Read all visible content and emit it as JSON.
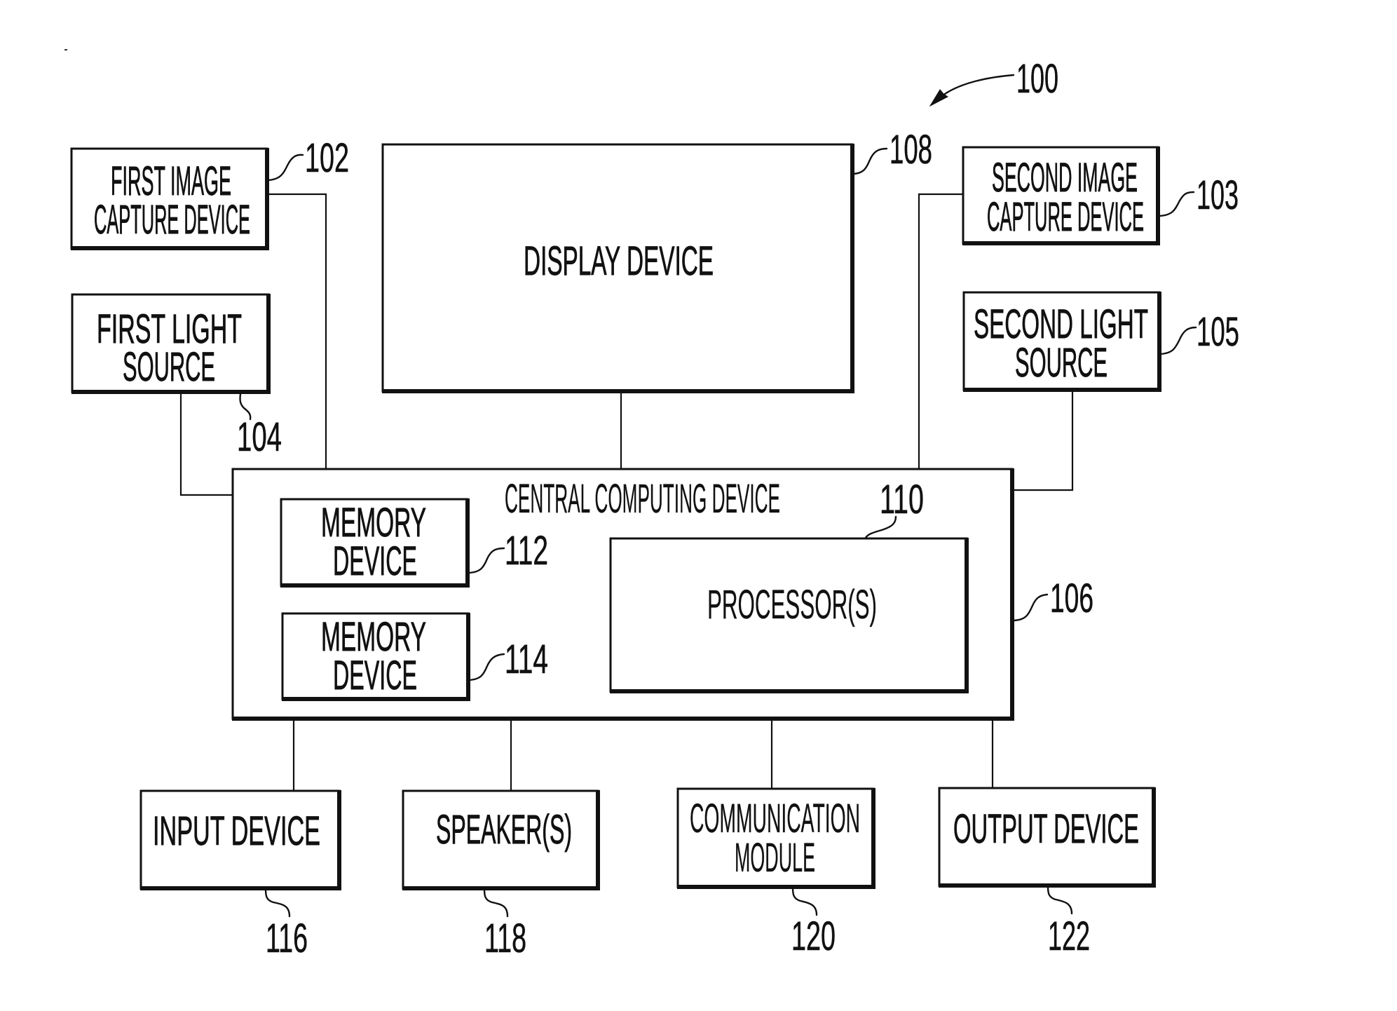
{
  "figure": {
    "ref": "100"
  },
  "blocks": {
    "first_image_capture_device": {
      "lines": [
        "FIRST IMAGE",
        "CAPTURE DEVICE"
      ],
      "ref": "102"
    },
    "second_image_capture_device": {
      "lines": [
        "SECOND IMAGE",
        "CAPTURE DEVICE"
      ],
      "ref": "103"
    },
    "first_light_source": {
      "lines": [
        "FIRST LIGHT",
        "SOURCE"
      ],
      "ref": "104"
    },
    "second_light_source": {
      "lines": [
        "SECOND LIGHT",
        "SOURCE"
      ],
      "ref": "105"
    },
    "central_computing_device": {
      "lines": [
        "CENTRAL COMPUTING DEVICE"
      ],
      "ref": "106"
    },
    "display_device": {
      "lines": [
        "DISPLAY DEVICE"
      ],
      "ref": "108"
    },
    "processors": {
      "lines": [
        "PROCESSOR(S)"
      ],
      "ref": "110"
    },
    "memory_device_1": {
      "lines": [
        "MEMORY",
        "DEVICE"
      ],
      "ref": "112"
    },
    "memory_device_2": {
      "lines": [
        "MEMORY",
        "DEVICE"
      ],
      "ref": "114"
    },
    "input_device": {
      "lines": [
        "INPUT DEVICE"
      ],
      "ref": "116"
    },
    "speakers": {
      "lines": [
        "SPEAKER(S)"
      ],
      "ref": "118"
    },
    "communication_module": {
      "lines": [
        "COMMUNICATION",
        "MODULE"
      ],
      "ref": "120"
    },
    "output_device": {
      "lines": [
        "OUTPUT DEVICE"
      ],
      "ref": "122"
    }
  },
  "connections": [
    [
      "first_image_capture_device",
      "central_computing_device"
    ],
    [
      "first_light_source",
      "central_computing_device"
    ],
    [
      "display_device",
      "central_computing_device"
    ],
    [
      "second_image_capture_device",
      "central_computing_device"
    ],
    [
      "second_light_source",
      "central_computing_device"
    ],
    [
      "central_computing_device",
      "input_device"
    ],
    [
      "central_computing_device",
      "speakers"
    ],
    [
      "central_computing_device",
      "communication_module"
    ],
    [
      "central_computing_device",
      "output_device"
    ]
  ]
}
